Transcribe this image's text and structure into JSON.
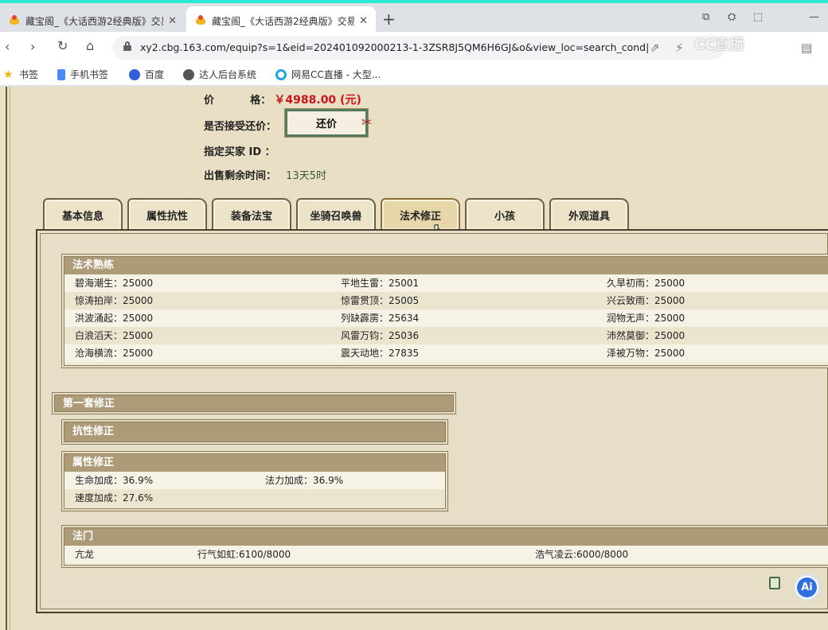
{
  "browser": {
    "tabs": [
      {
        "title": "藏宝阁_《大话西游2经典版》交易",
        "active": false
      },
      {
        "title": "藏宝阁_《大话西游2经典版》交易",
        "active": true
      }
    ],
    "url": "xy2.cbg.163.com/equip?s=1&eid=202401092000213-1-3ZSR8J5QM6H6GJ&o&view_loc=search_cond|%7B\"...",
    "bookmarks": [
      "书签",
      "手机书签",
      "百度",
      "达人后台系统",
      "网易CC直播 - 大型..."
    ],
    "watermark": "CC直播"
  },
  "listing": {
    "price_label": "价          格：",
    "price_value": "￥4988.00 (元)",
    "accept_counter_label": "是否接受还价：",
    "counter_button": "还价",
    "buyer_id_label": "指定买家 ID ：",
    "time_left_label": "出售剩余时间：",
    "time_left_value": "13天5时"
  },
  "tabs": [
    "基本信息",
    "属性抗性",
    "装备法宝",
    "坐骑召唤兽",
    "法术修正",
    "小孩",
    "外观道具"
  ],
  "active_tab": "法术修正",
  "spell_mastery": {
    "title": "法术熟练",
    "rows": [
      [
        "碧海潮生：25000",
        "平地生雷：25001",
        "久旱初雨：25000"
      ],
      [
        "惊涛拍岸：25000",
        "惊雷贯顶：25005",
        "兴云致雨：25000"
      ],
      [
        "洪波涌起：25000",
        "列缺霹雳：25634",
        "润物无声：25000"
      ],
      [
        "白浪滔天：25000",
        "风雷万钧：25036",
        "沛然莫御：25000"
      ],
      [
        "沧海横流：25000",
        "震天动地：27835",
        "泽被万物：25000"
      ]
    ]
  },
  "first_set": {
    "title": "第一套修正",
    "resist_title": "抗性修正",
    "attr_title": "属性修正",
    "attr_rows": [
      [
        "生命加成：36.9%",
        "法力加成：36.9%"
      ],
      [
        "速度加成：27.6%",
        ""
      ]
    ]
  },
  "school": {
    "title": "法门",
    "items": [
      "亢龙",
      "行气如虹:6100/8000",
      "浩气凌云:6000/8000"
    ]
  },
  "colors": {
    "price": "#c8161d",
    "section_header": "#ac9b76",
    "page_bg": "#e8dfc4",
    "accent_tab_strip": "#2ee8d8"
  }
}
